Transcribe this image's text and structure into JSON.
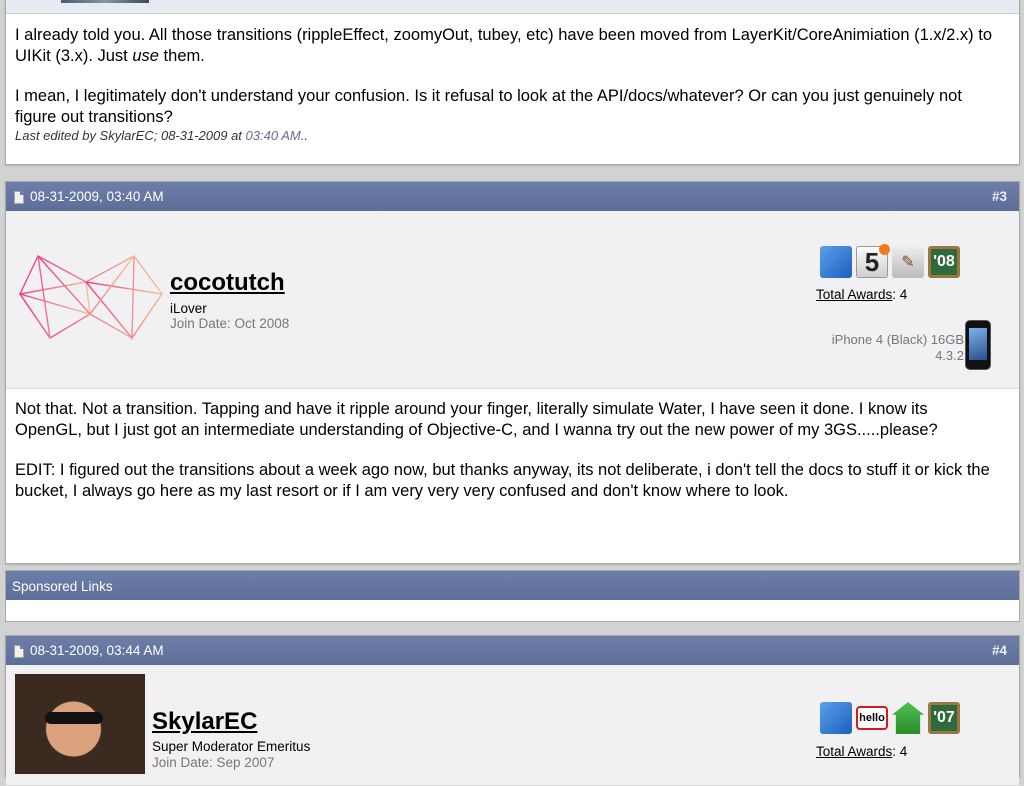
{
  "post_prev": {
    "paragraphs": [
      "I already told you. All those transitions (rippleEffect, zoomyOut, tubey, etc) have been moved from LayerKit/CoreAnimiation (1.x/2.x) to UIKit (3.x). Just ",
      "I mean, I legitimately don't understand your confusion. Is it refusal to look at the API/docs/whatever? Or can you just genuinely not figure out transitions?"
    ],
    "emph_word": "use",
    "after_emph": " them.",
    "edited_prefix": "Last edited by SkylarEC; 08-31-2009 at ",
    "edited_time": "03:40 AM",
    "edited_suffix": ".."
  },
  "post3": {
    "date": "08-31-2009, 03:40 AM",
    "number": "#3",
    "username": "cocotutch",
    "user_title": "iLover",
    "join_date": "Join Date: Oct 2008",
    "badges": [
      {
        "name": "xcode-award-icon",
        "text": ""
      },
      {
        "name": "five-award-icon",
        "text": "5"
      },
      {
        "name": "tools-award-icon",
        "text": "✎"
      },
      {
        "name": "year-08-award-icon",
        "text": "'08"
      }
    ],
    "awards_label": "Total Awards",
    "awards_count": ": 4",
    "device_line1": "iPhone 4 (Black) 16GB",
    "device_line2": "4.3.2",
    "body": [
      "Not that. Not a transition. Tapping and have it ripple around your finger, literally simulate Water, I have seen it done. I know its OpenGL, but I just got an intermediate understanding of Objective-C, and I wanna try out the new power of my 3GS.....please?",
      "EDIT: I figured out the transitions about a week ago now, but thanks anyway, its not deliberate, i don't tell the docs to stuff it or kick the bucket, I always go here as my last resort or if I am very very very confused and don't know where to look."
    ]
  },
  "sponsored": {
    "label": "Sponsored Links"
  },
  "post4": {
    "date": "08-31-2009, 03:44 AM",
    "number": "#4",
    "username": "SkylarEC",
    "user_title": "Super Moderator Emeritus",
    "join_date": "Join Date: Sep 2007",
    "badges": [
      {
        "name": "xcode-award-icon",
        "text": ""
      },
      {
        "name": "hello-award-icon",
        "text": "hello"
      },
      {
        "name": "house-award-icon",
        "text": ""
      },
      {
        "name": "year-07-award-icon",
        "text": "'07"
      }
    ],
    "awards_label": "Total Awards",
    "awards_count": ": 4"
  },
  "colors": {
    "header_bg": "#6274a0",
    "userbar_bg": "#f1f1f4",
    "logo_pink": "#ee4d8a",
    "logo_peach": "#f2b48a"
  }
}
